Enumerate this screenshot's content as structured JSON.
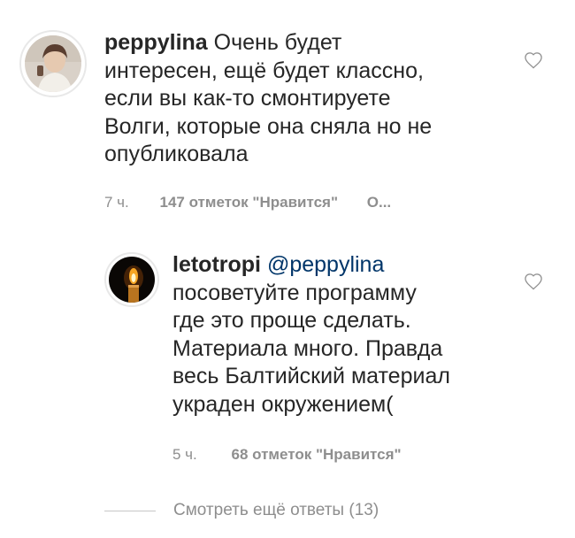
{
  "comments": [
    {
      "username": "peppylina",
      "text_first": "Очень будет",
      "lines": [
        "интересен, ещё будет классно,",
        "если вы как-то смонтируете",
        "Волги, которые она сняла но не",
        "опубликовала"
      ],
      "time": "7 ч.",
      "likes": "147 отметок \"Нравится\"",
      "reply": "О..."
    },
    {
      "username": "letotropi",
      "mention": "@peppylina",
      "lines": [
        "посоветуйте программу",
        "где это проще сделать.",
        "Материала много. Правда",
        "весь Балтийский материал",
        "украден окружением("
      ],
      "time": "5 ч.",
      "likes": "68 отметок \"Нравится\""
    }
  ],
  "view_more": "Смотреть ещё ответы (13)",
  "icons": {
    "like": "heart-icon"
  },
  "colors": {
    "text": "#262626",
    "meta": "#8e8e8e",
    "mention": "#003569"
  }
}
